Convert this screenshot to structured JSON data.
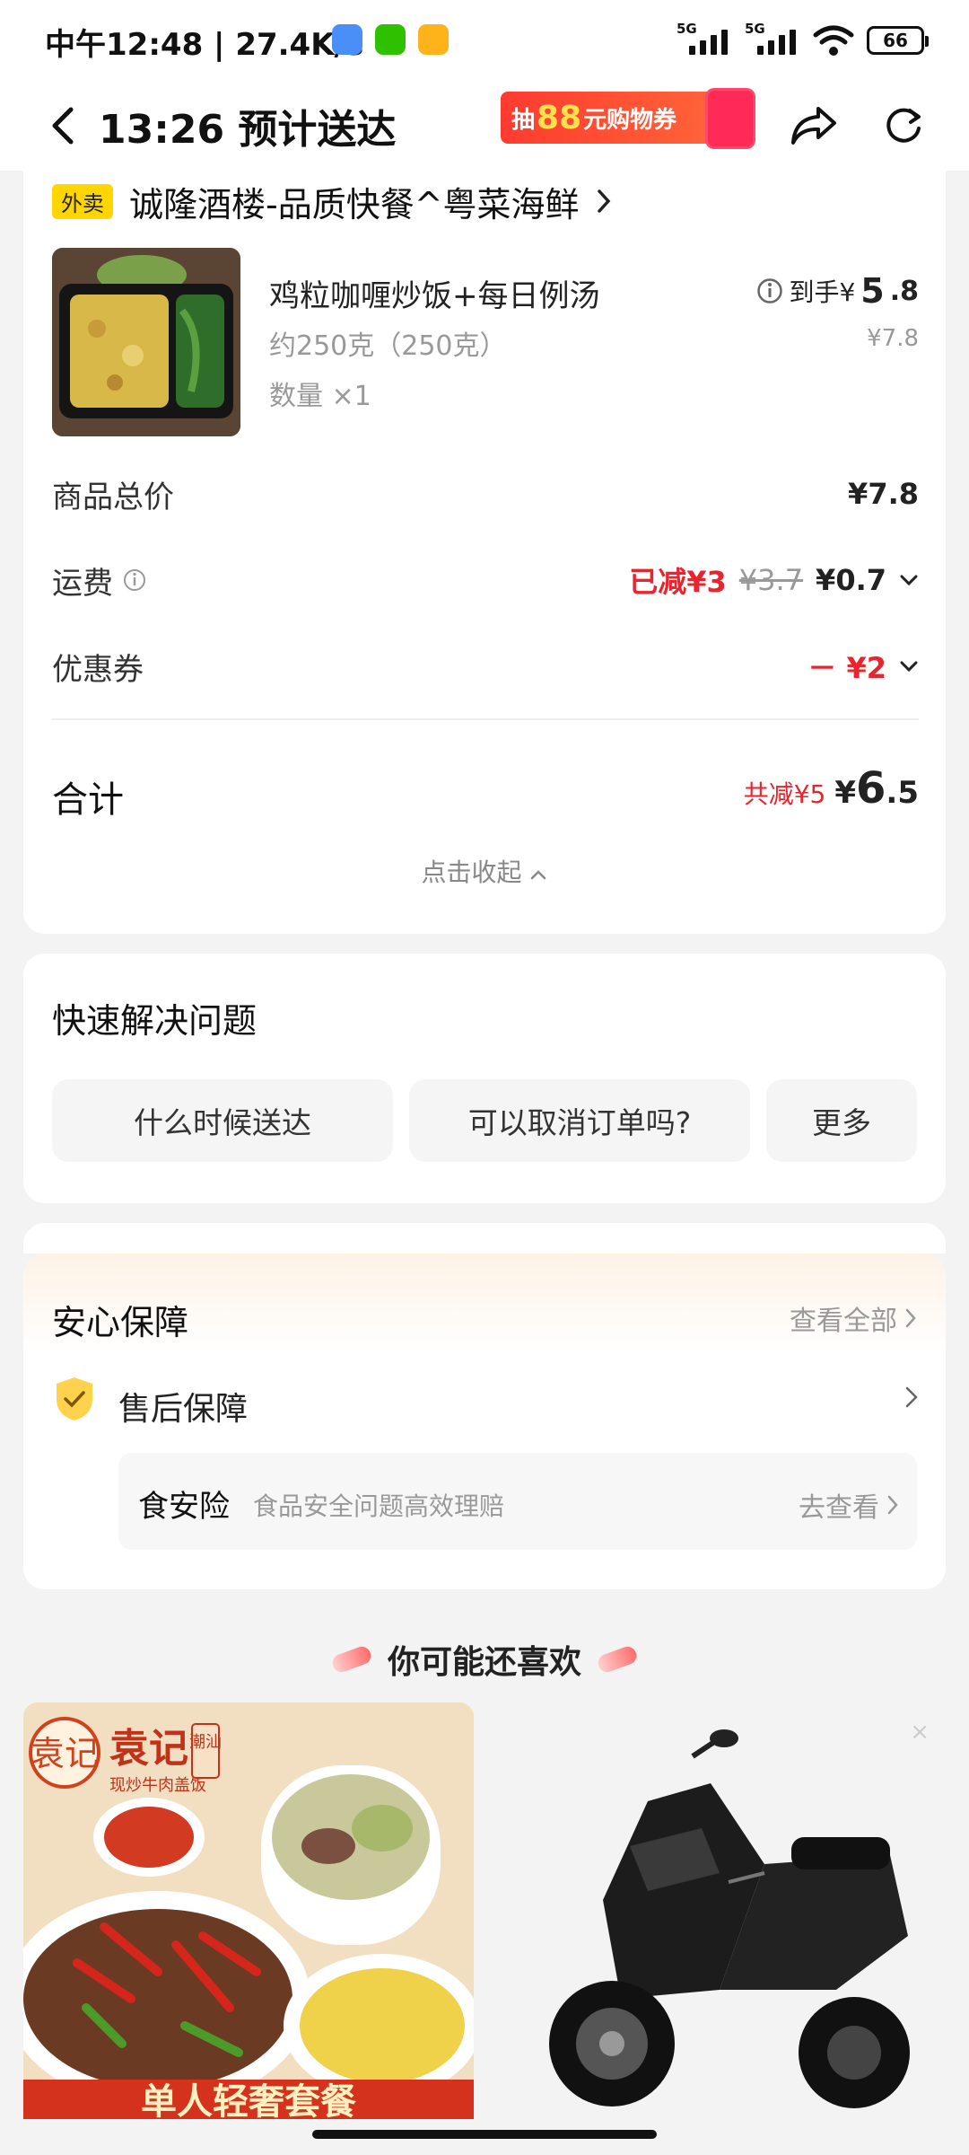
{
  "status_bar": {
    "time": "中午12:48 | 27.4K/s",
    "network_1": "5G",
    "network_2": "5G",
    "battery": "66"
  },
  "header": {
    "title": "13:26 预计送达",
    "promo_prefix": "抽",
    "promo_amount": "88",
    "promo_suffix": "元购物券"
  },
  "order": {
    "store_tag": "外卖",
    "store_name": "诚隆酒楼-品质快餐^粤菜海鲜",
    "item": {
      "name": "鸡粒咖喱炒饭+每日例汤",
      "weight": "约250克（250克）",
      "quantity": "数量 ×1",
      "price_label": "到手¥",
      "price_int": "5",
      "price_dec": ".8",
      "original_price": "¥7.8"
    },
    "subtotal_label": "商品总价",
    "subtotal_value": "¥7.8",
    "delivery_label": "运费",
    "delivery_discount": "已减¥3",
    "delivery_original": "¥3.7",
    "delivery_value": "¥0.7",
    "coupon_label": "优惠券",
    "coupon_value": "－ ¥2",
    "total_label": "合计",
    "total_saved": "共减¥5",
    "total_yen": "¥",
    "total_int": "6",
    "total_dec": ".5",
    "collapse_label": "点击收起"
  },
  "quick_help": {
    "title": "快速解决问题",
    "buttons": [
      "什么时候送达",
      "可以取消订单吗?",
      "更多"
    ]
  },
  "guarantee": {
    "title": "安心保障",
    "view_all": "查看全部",
    "after_sale": "售后保障",
    "insurance_title": "食安险",
    "insurance_desc": "食品安全问题高效理赔",
    "insurance_action": "去查看"
  },
  "recommend": {
    "title": "你可能还喜欢",
    "card1_brand": "袁记",
    "card1_brand_tag": "潮汕",
    "card1_subtitle": "现炒牛肉盖饭",
    "card1_banner": "单人轻奢套餐",
    "close_icon": "×"
  },
  "colors": {
    "accent_red": "#e8242f",
    "tag_yellow": "#ffd600",
    "background": "#f3f3f3"
  }
}
